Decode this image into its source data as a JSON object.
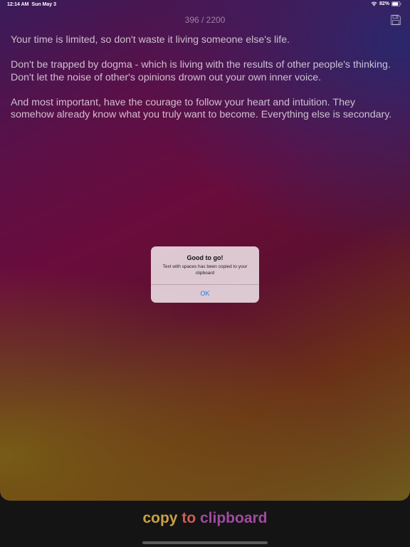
{
  "status_bar": {
    "time": "12:14 AM",
    "date": "Sun May 3",
    "battery_percent": "82%",
    "battery_level": 0.82
  },
  "header": {
    "counter": "396 / 2200",
    "save_icon": "floppy-disk-icon"
  },
  "content": {
    "paragraphs": [
      "Your time is limited, so don't waste it living someone else's life.",
      "Don't be trapped by dogma - which is living with the results of other people's thinking. Don't let the noise of other's opinions drown out your own inner voice.",
      "And most important, have the courage to follow your heart and intuition. They somehow already know what you truly want to become. Everything else is secondary."
    ]
  },
  "alert": {
    "title": "Good to go!",
    "message": "Text with spaces has been copied to your clipboard",
    "ok_label": "OK"
  },
  "footer": {
    "copy_word": "copy",
    "to_word": "to",
    "clipboard_word": "clipboard"
  },
  "colors": {
    "copy_word": "#caa145",
    "to_word": "#cf5d55",
    "clipboard_word": "#a04aa0",
    "ok_button": "#1f7ef5",
    "background": "#141414"
  }
}
